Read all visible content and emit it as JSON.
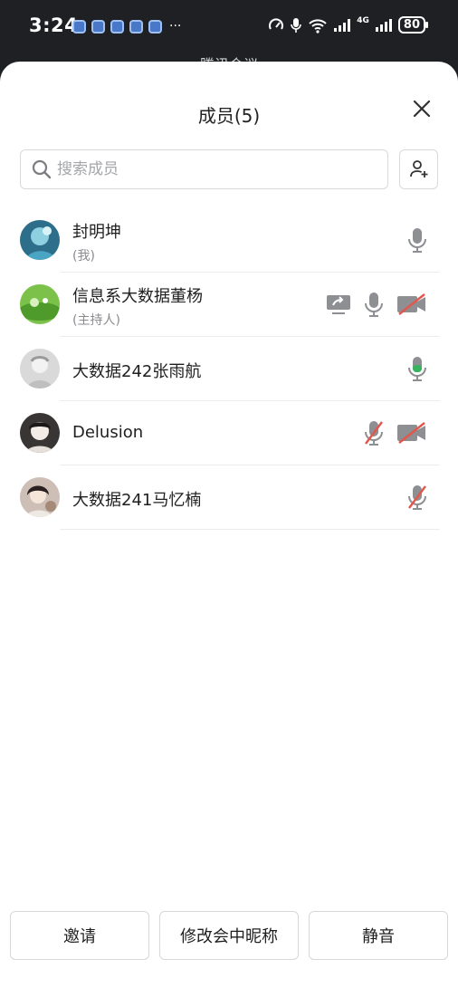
{
  "status_bar": {
    "time": "3:24",
    "more": "···",
    "network": "4G",
    "battery": "80"
  },
  "background_title": "腾讯会议",
  "sheet": {
    "title": "成员(5)",
    "search_placeholder": "搜索成员"
  },
  "members": [
    {
      "name": "封明坤",
      "tag": "(我)",
      "share": false,
      "mic": "on-gray",
      "video": null
    },
    {
      "name": "信息系大数据董杨",
      "tag": "(主持人)",
      "share": true,
      "mic": "on-gray",
      "video": "off"
    },
    {
      "name": "大数据242张雨航",
      "tag": "",
      "share": false,
      "mic": "on-green",
      "video": null
    },
    {
      "name": "Delusion",
      "tag": "",
      "share": false,
      "mic": "off",
      "video": "off"
    },
    {
      "name": "大数据241马忆楠",
      "tag": "",
      "share": false,
      "mic": "off",
      "video": null
    }
  ],
  "colors": {
    "muted_red": "#e2574c",
    "speaking_green": "#35b35d",
    "icon_gray": "#8d8f93"
  },
  "buttons": {
    "invite": "邀请",
    "rename": "修改会中昵称",
    "mute": "静音"
  }
}
